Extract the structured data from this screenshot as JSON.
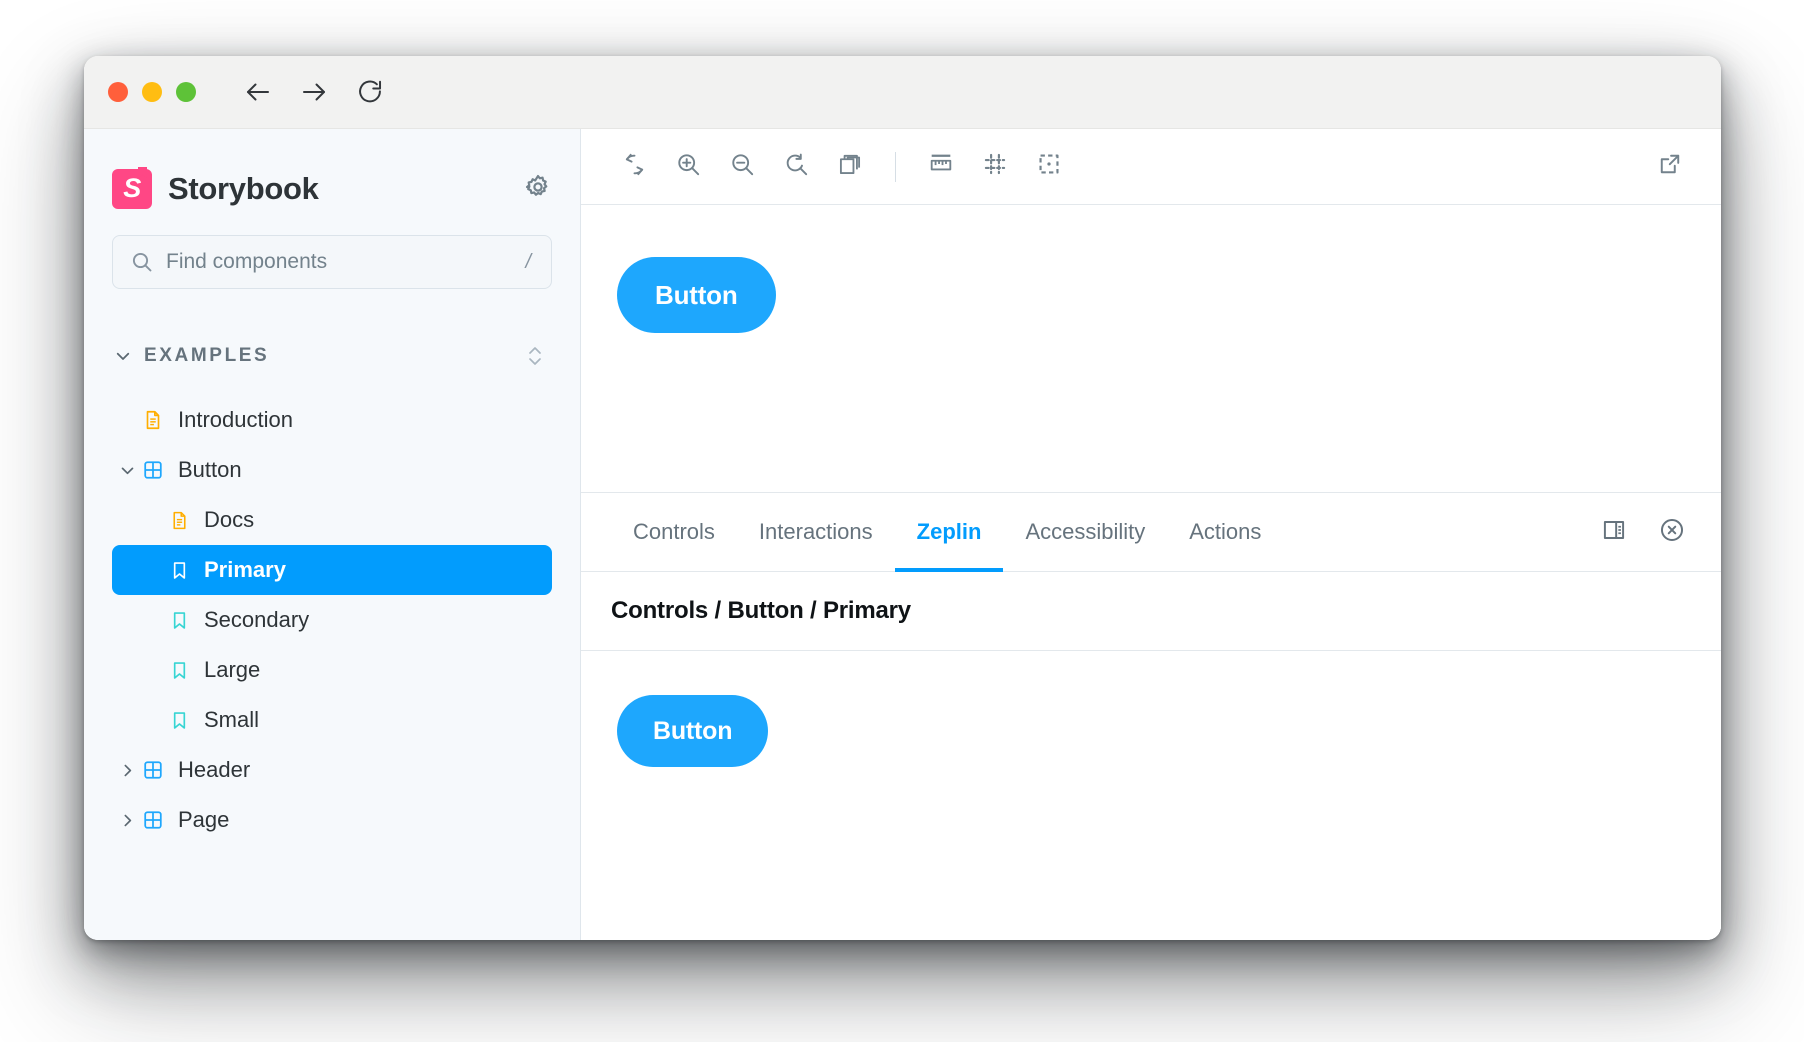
{
  "window": {
    "traffic_lights": [
      {
        "name": "close",
        "color": "#ff5f3b"
      },
      {
        "name": "minimize",
        "color": "#ffbd12"
      },
      {
        "name": "maximize",
        "color": "#5ec238"
      }
    ],
    "nav": [
      {
        "name": "back",
        "icon": "arrow-left-icon"
      },
      {
        "name": "forward",
        "icon": "arrow-right-icon"
      },
      {
        "name": "reload",
        "icon": "reload-icon"
      }
    ]
  },
  "sidebar": {
    "brand": {
      "logo_letter": "S",
      "name": "Storybook",
      "logo_color": "#ff4785"
    },
    "settings_icon": "gear-icon",
    "search": {
      "placeholder": "Find components",
      "value": "",
      "shortcut": "/"
    },
    "heading": {
      "label": "EXAMPLES",
      "expanded": true,
      "sort_icon": "sort-updown-icon"
    },
    "items": [
      {
        "label": "Introduction",
        "icon": "document-icon",
        "icon_color": "#ffae00",
        "indent": 1,
        "twisty": "",
        "selected": false
      },
      {
        "label": "Button",
        "icon": "component-icon",
        "icon_color": "#1ea7fd",
        "indent": 0,
        "twisty": "down",
        "selected": false
      },
      {
        "label": "Docs",
        "icon": "document-icon",
        "icon_color": "#ffae00",
        "indent": 2,
        "twisty": "",
        "selected": false
      },
      {
        "label": "Primary",
        "icon": "bookmark-icon",
        "icon_color": "#ffffff",
        "indent": 2,
        "twisty": "",
        "selected": true
      },
      {
        "label": "Secondary",
        "icon": "bookmark-icon",
        "icon_color": "#37d5d3",
        "indent": 2,
        "twisty": "",
        "selected": false
      },
      {
        "label": "Large",
        "icon": "bookmark-icon",
        "icon_color": "#37d5d3",
        "indent": 2,
        "twisty": "",
        "selected": false
      },
      {
        "label": "Small",
        "icon": "bookmark-icon",
        "icon_color": "#37d5d3",
        "indent": 2,
        "twisty": "",
        "selected": false
      },
      {
        "label": "Header",
        "icon": "component-icon",
        "icon_color": "#1ea7fd",
        "indent": 0,
        "twisty": "right",
        "selected": false
      },
      {
        "label": "Page",
        "icon": "component-icon",
        "icon_color": "#1ea7fd",
        "indent": 0,
        "twisty": "right",
        "selected": false
      }
    ]
  },
  "toolbar": {
    "left_tools": [
      {
        "name": "remount-button",
        "icon": "reload-circular-icon"
      },
      {
        "name": "zoom-in-button",
        "icon": "zoom-in-icon"
      },
      {
        "name": "zoom-out-button",
        "icon": "zoom-out-icon"
      },
      {
        "name": "zoom-reset-button",
        "icon": "zoom-reset-icon"
      },
      {
        "name": "background-button",
        "icon": "layers-icon"
      }
    ],
    "right_tools": [
      {
        "name": "measure-button",
        "icon": "ruler-icon"
      },
      {
        "name": "grid-button",
        "icon": "grid-icon"
      },
      {
        "name": "outline-button",
        "icon": "outline-icon"
      }
    ],
    "open_new_tab": {
      "name": "open-in-new-tab-button",
      "icon": "external-link-icon"
    }
  },
  "preview": {
    "button_label": "Button",
    "button_color": "#1ea7fd"
  },
  "panel": {
    "tabs": [
      {
        "label": "Controls",
        "active": false
      },
      {
        "label": "Interactions",
        "active": false
      },
      {
        "label": "Zeplin",
        "active": true
      },
      {
        "label": "Accessibility",
        "active": false
      },
      {
        "label": "Actions",
        "active": false
      }
    ],
    "actions": [
      {
        "name": "panel-position-button",
        "icon": "panel-layout-icon"
      },
      {
        "name": "close-panel-button",
        "icon": "close-circle-icon"
      }
    ],
    "title": "Controls / Button / Primary",
    "button_label": "Button",
    "accent_color": "#029cfd"
  }
}
